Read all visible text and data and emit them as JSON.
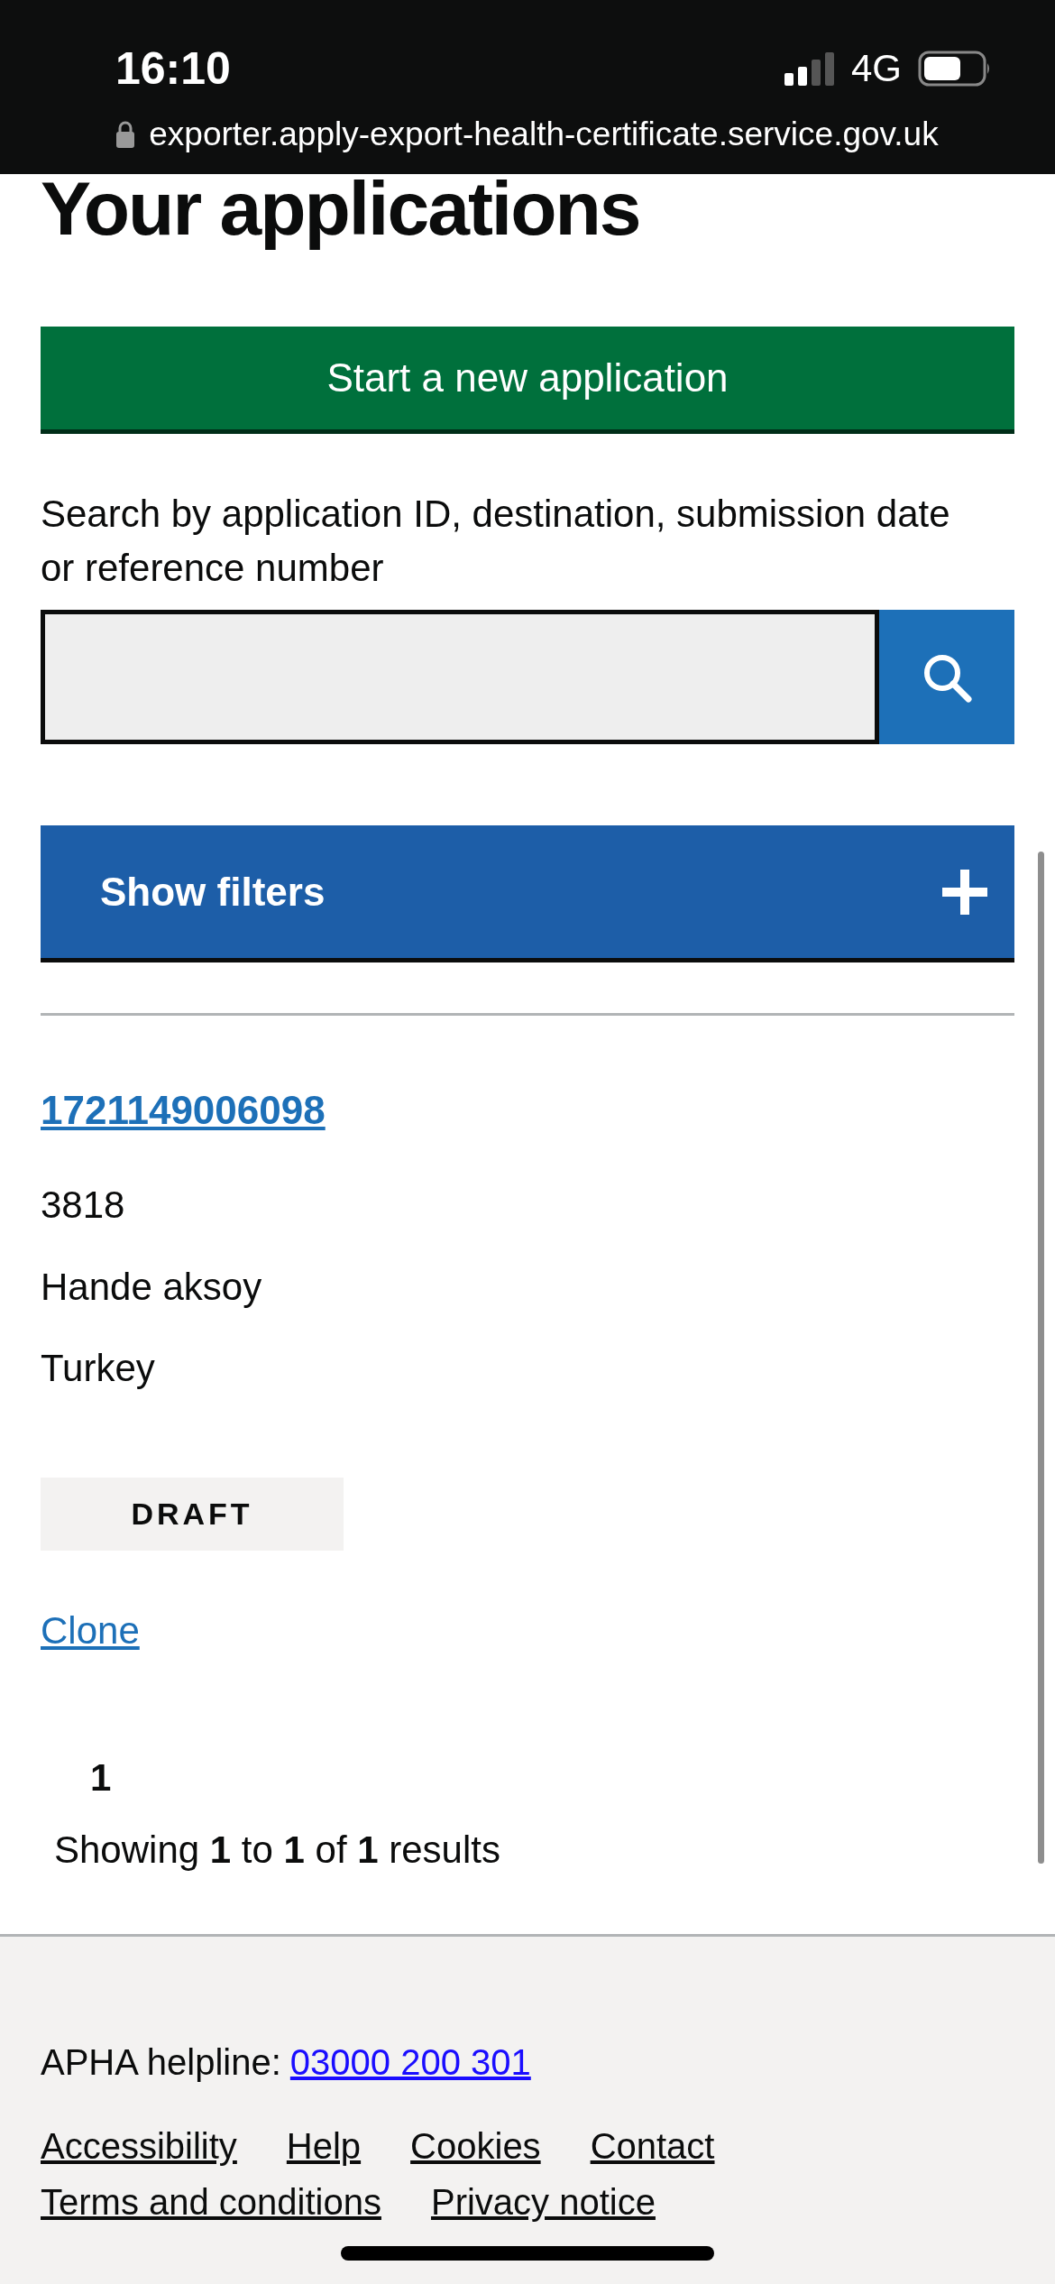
{
  "status_bar": {
    "time": "16:10",
    "network": "4G",
    "url": "exporter.apply-export-health-certificate.service.gov.uk"
  },
  "heading": "Your applications",
  "start_button": "Start a new application",
  "search": {
    "label": "Search by application ID, destination, submission date or reference number"
  },
  "filters_toggle": {
    "label": "Show filters",
    "expanded": false
  },
  "applications": [
    {
      "id": "1721149006098",
      "reference": "3818",
      "name": "Hande aksoy",
      "destination": "Turkey",
      "status": "DRAFT",
      "action": "Clone"
    }
  ],
  "pagination": {
    "pages": [
      {
        "label": "1",
        "selected": true
      }
    ],
    "summary": "Showing **1** to **1** of **1** results"
  },
  "footer": {
    "helpline_label": "APHA helpline:",
    "helpline_number": "03000 200 301",
    "links": [
      "Accessibility",
      "Help",
      "Cookies",
      "Contact",
      "Terms and conditions",
      "Privacy notice"
    ]
  }
}
